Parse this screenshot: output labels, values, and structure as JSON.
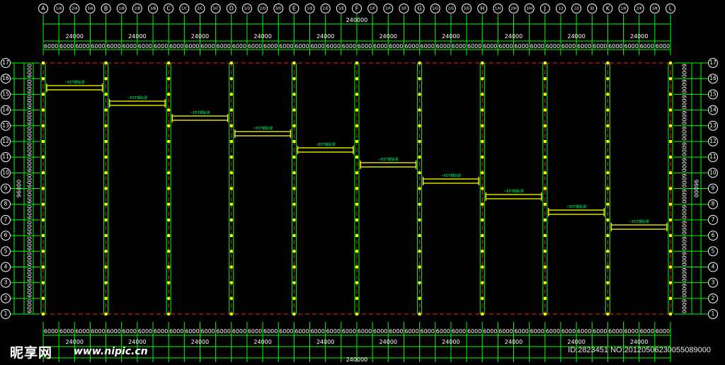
{
  "colors": {
    "background": "#000000",
    "grid_line": "#00ff00",
    "dimension_text": "#ffffff",
    "column_line": "#00ff00",
    "axis_dashed": "#ff2020",
    "steel_beam": "#ffff00",
    "beam_label": "#00ff66",
    "bubble": "#ffffff"
  },
  "grid": {
    "top_axis_labels": [
      "A",
      "1/A",
      "2/A",
      "3/A",
      "B",
      "1/B",
      "2/B",
      "3/B",
      "C",
      "1/C",
      "2/C",
      "3/C",
      "D",
      "1/D",
      "2/D",
      "3/D",
      "E",
      "1/E",
      "2/E",
      "3/E",
      "F",
      "1/F",
      "2/F",
      "3/F",
      "G",
      "1/G",
      "2/G",
      "3/G",
      "H",
      "1/H",
      "2/H",
      "3/H",
      "J",
      "1/J",
      "2/J",
      "3/J",
      "K",
      "1/K",
      "2/K",
      "3/K",
      "L"
    ],
    "row_labels": [
      "17",
      "16",
      "15",
      "14",
      "13",
      "12",
      "11",
      "10",
      "9",
      "8",
      "7",
      "6",
      "5",
      "4",
      "3",
      "2",
      "1"
    ]
  },
  "dimensions": {
    "overall": "240000",
    "bay": "24000",
    "sub_bay": "6000",
    "vertical_overall": "96000",
    "vertical_sub": "6000"
  },
  "beam_label": "~65T钢轨梁",
  "watermark": {
    "logo": "昵享网",
    "url": "www.nipic.cn",
    "id_text": "ID:2823451 NO:20120506230055089000"
  }
}
